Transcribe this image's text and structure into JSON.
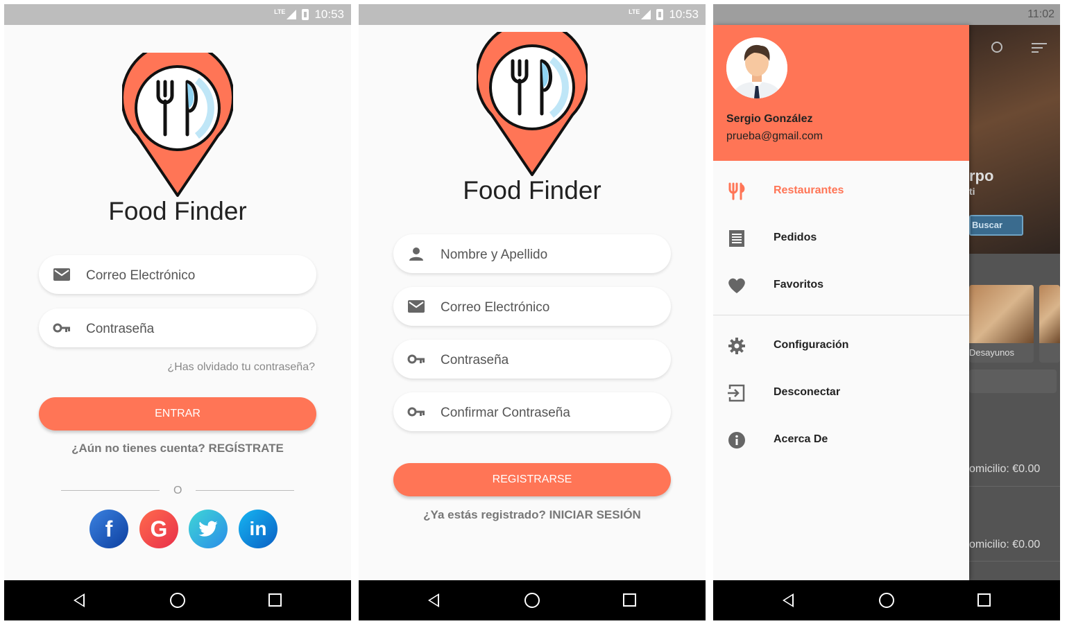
{
  "status_bar": {
    "time_1": "10:53",
    "time_2": "10:53",
    "lte": "LTE"
  },
  "login": {
    "app_title": "Food Finder",
    "email_placeholder": "Correo Electrónico",
    "password_placeholder": "Contraseña",
    "forgot_password": "¿Has olvidado tu contraseña?",
    "submit_label": "ENTRAR",
    "register_prompt": "¿Aún no tienes cuenta? REGÍSTRATE",
    "or_label": "O",
    "social": [
      {
        "name": "facebook",
        "glyph": "f",
        "color": "#1e5bbf"
      },
      {
        "name": "google",
        "glyph": "G",
        "color": "#f04a3e"
      },
      {
        "name": "twitter",
        "glyph": "t",
        "color": "#2fb3e6"
      },
      {
        "name": "linkedin",
        "glyph": "in",
        "color": "#0a7ad0"
      }
    ]
  },
  "register": {
    "app_title": "Food Finder",
    "name_placeholder": "Nombre y Apellido",
    "email_placeholder": "Correo Electrónico",
    "password_placeholder": "Contraseña",
    "confirm_password_placeholder": "Confirmar Contraseña",
    "submit_label": "REGISTRARSE",
    "login_prompt": "¿Ya estás registrado? INICIAR SESIÓN"
  },
  "drawer": {
    "user_name": "Sergio González",
    "user_email": "prueba@gmail.com",
    "items": [
      {
        "label": "Restaurantes",
        "icon": "cutlery-icon",
        "active": true
      },
      {
        "label": "Pedidos",
        "icon": "receipt-icon",
        "active": false
      },
      {
        "label": "Favoritos",
        "icon": "heart-icon",
        "active": false
      },
      {
        "label": "Configuración",
        "icon": "gear-icon",
        "active": false
      },
      {
        "label": "Desconectar",
        "icon": "logout-icon",
        "active": false
      },
      {
        "label": "Acerca De",
        "icon": "info-icon",
        "active": false
      }
    ],
    "background": {
      "time": "11:02",
      "hero_text_1": "rpo",
      "hero_text_2": "ti",
      "search_button": "Buscar",
      "category_label": "Desayunos",
      "delivery_1": "omicilio: €0.00",
      "delivery_2": "omicilio: €0.00"
    }
  },
  "colors": {
    "accent": "#ff7556",
    "background": "#fafafa"
  }
}
